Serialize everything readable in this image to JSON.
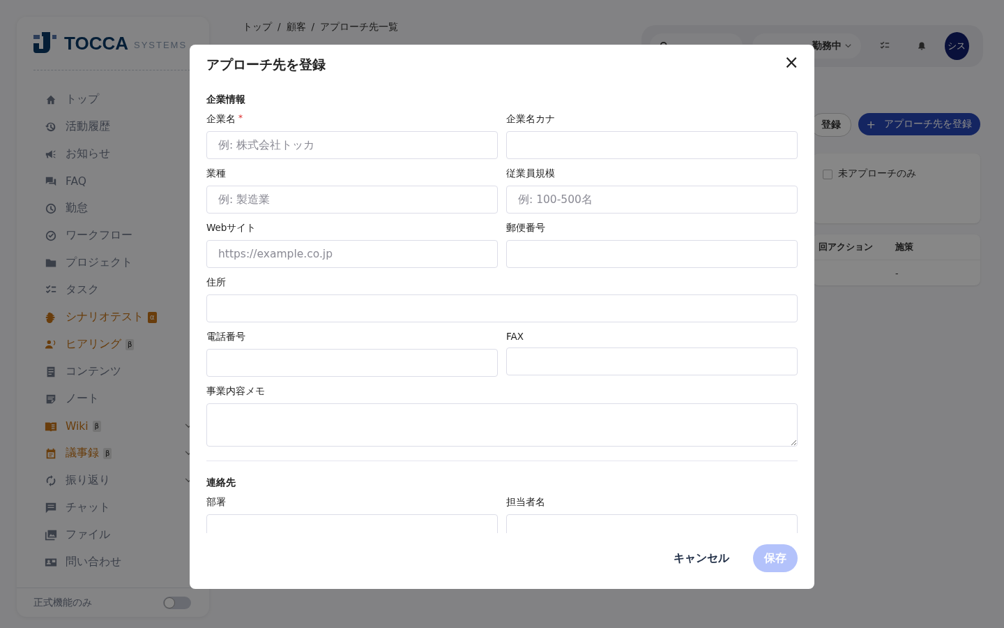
{
  "logo": {
    "name": "TOCCA",
    "suffix": "SYSTEMS"
  },
  "sidebar": {
    "items": [
      {
        "label": "トップ",
        "highlighted": false,
        "expandable": false
      },
      {
        "label": "活動履歴",
        "highlighted": false,
        "expandable": false
      },
      {
        "label": "お知らせ",
        "highlighted": false,
        "expandable": false
      },
      {
        "label": "FAQ",
        "highlighted": false,
        "expandable": false
      },
      {
        "label": "勤怠",
        "highlighted": false,
        "expandable": false
      },
      {
        "label": "ワークフロー",
        "highlighted": false,
        "expandable": false
      },
      {
        "label": "プロジェクト",
        "highlighted": false,
        "expandable": false
      },
      {
        "label": "タスク",
        "highlighted": false,
        "expandable": false
      },
      {
        "label": "シナリオテスト",
        "highlighted": true,
        "badge": {
          "text": "α",
          "kind": "alpha"
        },
        "expandable": false
      },
      {
        "label": "ヒアリング",
        "highlighted": true,
        "badge": {
          "text": "β",
          "kind": "beta"
        },
        "expandable": false
      },
      {
        "label": "コンテンツ",
        "highlighted": false,
        "expandable": false
      },
      {
        "label": "ノート",
        "highlighted": false,
        "expandable": false
      },
      {
        "label": "Wiki",
        "highlighted": true,
        "badge": {
          "text": "β",
          "kind": "beta"
        },
        "expandable": true
      },
      {
        "label": "議事録",
        "highlighted": true,
        "badge": {
          "text": "β",
          "kind": "beta"
        },
        "expandable": true
      },
      {
        "label": "振り返り",
        "highlighted": false,
        "expandable": true
      },
      {
        "label": "チャット",
        "highlighted": false,
        "expandable": false
      },
      {
        "label": "ファイル",
        "highlighted": false,
        "expandable": false
      },
      {
        "label": "問い合わせ",
        "highlighted": false,
        "expandable": false
      }
    ],
    "toggle": {
      "label": "正式機能のみ",
      "on": false
    }
  },
  "breadcrumb": {
    "separator": "/",
    "items": [
      "トップ",
      "顧客",
      "アプローチ先一覧"
    ]
  },
  "header": {
    "status": "勤務中",
    "avatar": "シス"
  },
  "actions": {
    "partial_button": "登録",
    "register_button": "アプローチ先を登録",
    "register_icon": "+"
  },
  "filter": {
    "checkbox_label": "未アプローチのみ",
    "checked": false
  },
  "table": {
    "columns": [
      "回アクション",
      "施策"
    ],
    "rows": [
      [
        "",
        "-"
      ]
    ]
  },
  "modal": {
    "title": "アプローチ先を登録",
    "close": "×",
    "sections": [
      {
        "title": "企業情報",
        "fields": [
          {
            "label": "企業名",
            "required_mark": "*",
            "placeholder": "例: 株式会社トッカ",
            "wide": false,
            "kind": "input"
          },
          {
            "label": "企業名カナ",
            "wide": false,
            "kind": "input"
          },
          {
            "label": "業種",
            "placeholder": "例: 製造業",
            "wide": false,
            "kind": "input"
          },
          {
            "label": "従業員規模",
            "placeholder": "例: 100-500名",
            "wide": false,
            "kind": "input"
          },
          {
            "label": "Webサイト",
            "placeholder": "https://example.co.jp",
            "wide": false,
            "kind": "input"
          },
          {
            "label": "郵便番号",
            "wide": false,
            "kind": "input"
          },
          {
            "label": "住所",
            "wide": true,
            "kind": "input"
          },
          {
            "label": "電話番号",
            "wide": false,
            "kind": "input"
          },
          {
            "label": "FAX",
            "wide": false,
            "kind": "input"
          },
          {
            "label": "事業内容メモ",
            "wide": true,
            "kind": "textarea"
          }
        ]
      },
      {
        "title": "連絡先",
        "fields": [
          {
            "label": "部署",
            "wide": false,
            "kind": "input"
          },
          {
            "label": "担当者名",
            "wide": false,
            "kind": "input"
          }
        ]
      }
    ],
    "cancel": "キャンセル",
    "save": "保存",
    "save_disabled": true
  }
}
